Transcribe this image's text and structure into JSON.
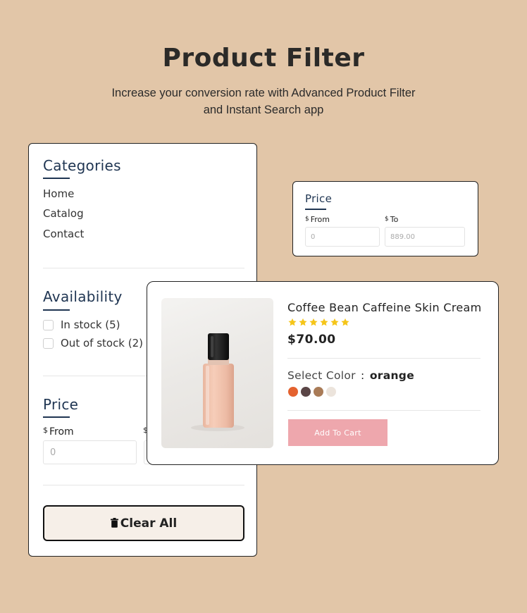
{
  "header": {
    "title": "Product Filter",
    "subtitle": "Increase your conversion rate with Advanced Product Filter and Instant Search app"
  },
  "filter": {
    "categories": {
      "heading": "Categories",
      "items": [
        "Home",
        "Catalog",
        "Contact"
      ]
    },
    "availability": {
      "heading": "Availability",
      "options": [
        "In stock (5)",
        "Out of stock (2)"
      ]
    },
    "price": {
      "heading": "Price",
      "currency": "$",
      "from_label": "From",
      "from_placeholder": "0",
      "to_currency": "$"
    },
    "clear_label": "Clear All",
    "clear_icon": "trash-icon"
  },
  "price_card": {
    "heading": "Price",
    "currency": "$",
    "from_label": "From",
    "to_label": "To",
    "from_placeholder": "0",
    "to_placeholder": "889.00"
  },
  "product": {
    "name": "Coffee Bean Caffeine Skin Cream",
    "rating": 6,
    "rating_max": 6,
    "price": "$70.00",
    "select_color_label": "Select Color",
    "separator": ":",
    "selected_color": "orange",
    "swatches": [
      "#e4622f",
      "#5a4546",
      "#a97b57",
      "#ece4dc"
    ],
    "add_to_cart": "Add To Cart"
  },
  "colors": {
    "background": "#e2c6a8",
    "heading_blue": "#1f3552",
    "star": "#f5c518",
    "cart_button": "#eea7ad",
    "clear_button_bg": "#f6efe8"
  }
}
